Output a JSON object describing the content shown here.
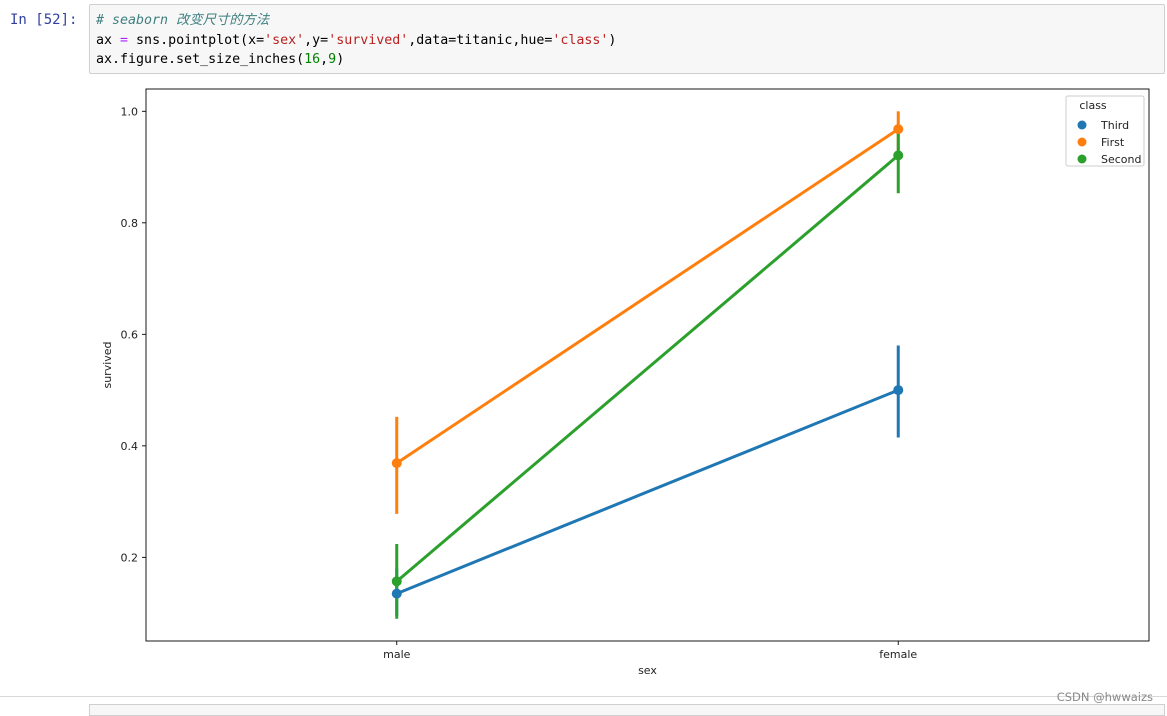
{
  "cell": {
    "prompt": "In  [52]:",
    "code": {
      "line1_comment": "# seaborn 改变尺寸的方法",
      "line2": {
        "a": "ax ",
        "eq": "=",
        "b": " sns.pointplot(x=",
        "s1": "'sex'",
        "c": ",y=",
        "s2": "'survived'",
        "d": ",data=titanic,hue=",
        "s3": "'class'",
        "e": ")"
      },
      "line3": {
        "a": "ax.figure.set_size_inches(",
        "n1": "16",
        "b": ",",
        "n2": "9",
        "c": ")"
      }
    }
  },
  "watermark": "CSDN @hwwaizs",
  "chart_data": {
    "type": "line",
    "xlabel": "sex",
    "ylabel": "survived",
    "categories": [
      "male",
      "female"
    ],
    "ylim": [
      0.05,
      1.04
    ],
    "yticks": [
      0.2,
      0.4,
      0.6,
      0.8,
      1.0
    ],
    "ytick_labels": [
      "0.2",
      "0.4",
      "0.6",
      "0.8",
      "1.0"
    ],
    "legend": {
      "title": "class",
      "placement": "top-right"
    },
    "grid": false,
    "series": [
      {
        "name": "Third",
        "color": "#1f77b4",
        "values": [
          0.135,
          0.5
        ],
        "ci": [
          [
            0.095,
            0.18
          ],
          [
            0.415,
            0.58
          ]
        ]
      },
      {
        "name": "First",
        "color": "#ff7f0e",
        "values": [
          0.369,
          0.968
        ],
        "ci": [
          [
            0.278,
            0.452
          ],
          [
            0.93,
            1.0
          ]
        ]
      },
      {
        "name": "Second",
        "color": "#2ca02c",
        "values": [
          0.157,
          0.921
        ],
        "ci": [
          [
            0.09,
            0.224
          ],
          [
            0.853,
            0.974
          ]
        ]
      }
    ]
  }
}
